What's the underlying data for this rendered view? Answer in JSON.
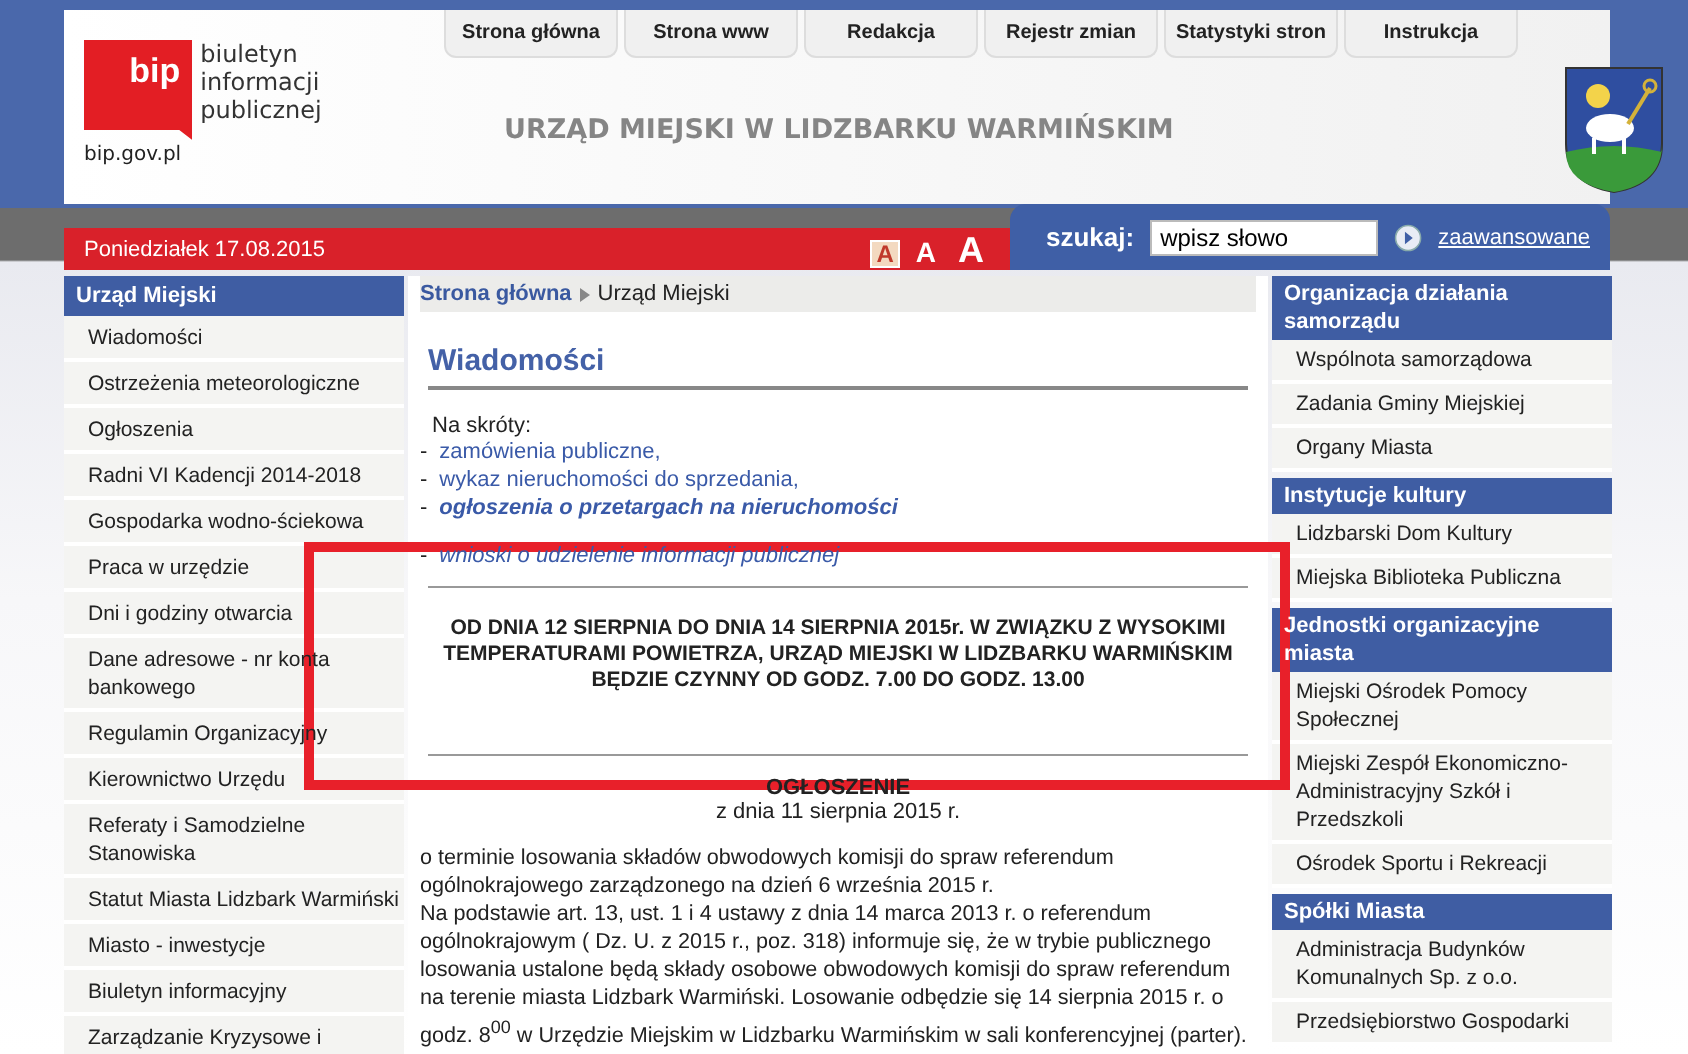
{
  "header": {
    "logo_line_1": "biuletyn",
    "logo_line_2": "informacji publicznej",
    "logo_mark": "bip",
    "logo_url": "bip.gov.pl",
    "title": "URZĄD MIEJSKI W LIDZBARKU WARMIŃSKIM",
    "tabs": [
      {
        "label": "Strona główna",
        "selected": false
      },
      {
        "label": "Strona www",
        "selected": false
      },
      {
        "label": "Redakcja",
        "selected": false
      },
      {
        "label": "Rejestr zmian",
        "selected": false
      },
      {
        "label": "Statystyki stron",
        "selected": false
      },
      {
        "label": "Instrukcja",
        "selected": false
      }
    ]
  },
  "date": "Poniedziałek 17.08.2015",
  "font_sizes": [
    {
      "label": "A",
      "selected": true
    },
    {
      "label": "A",
      "selected": false
    },
    {
      "label": "A",
      "selected": false
    }
  ],
  "search": {
    "label": "szukaj:",
    "value": "wpisz słowo",
    "advanced": "zaawansowane"
  },
  "left_menu": {
    "title": "Urząd Miejski",
    "items": [
      "Wiadomości",
      "Ostrzeżenia meteorologiczne",
      "Ogłoszenia",
      "Radni VI Kadencji 2014-2018",
      "Gospodarka wodno-ściekowa",
      "Praca w urzędzie",
      "Dni i godziny otwarcia",
      "Dane adresowe - nr konta bankowego",
      "Regulamin Organizacyjny",
      "Kierownictwo Urzędu",
      "Referaty i Samodzielne Stanowiska",
      "Statut Miasta Lidzbark Warmiński",
      "Miasto - inwestycje",
      "Biuletyn informacyjny",
      "Zarządzanie Kryzysowe i"
    ]
  },
  "breadcrumb": [
    "Strona główna",
    "Urząd Miejski"
  ],
  "heading": "Wiadomości",
  "shortcuts": {
    "title": "Na skróty:",
    "links": [
      {
        "marker": "-",
        "text": "zamówienia publiczne,",
        "kind": "plain"
      },
      {
        "marker": "-",
        "text": "wykaz nieruchomości do sprzedania,",
        "kind": "plain"
      },
      {
        "marker": "-",
        "text": "ogłoszenia o przetargach na nieruchomości",
        "kind": "emphasis"
      },
      {
        "marker": "-",
        "text": "wnioski o udzielenie informacji publicznej",
        "kind": "slanted"
      }
    ]
  },
  "notice": "OD DNIA 12 SIERPNIA DO DNIA 14 SIERPNIA 2015r. W ZWIĄZKU Z WYSOKIMI TEMPERATURAMI POWIETRZA, URZĄD MIEJSKI W LIDZBARKU WARMIŃSKIM BĘDZIE CZYNNY OD GODZ. 7.00 DO GODZ. 13.00",
  "announcement": {
    "title": "OGŁOSZENIE",
    "date": "z dnia 11 sierpnia 2015 r.",
    "paragraphs": [
      "o terminie losowania składów obwodowych komisji do spraw referendum ogólnokrajowego zarządzonego na dzień 6 września 2015 r.",
      "Na podstawie art. 13, ust. 1 i 4 ustawy z dnia 14 marca 2013 r. o referendum ogólnokrajowym ( Dz. U. z 2015 r., poz. 318) informuje się, że w trybie publicznego losowania ustalone będą składy osobowe obwodowych komisji do spraw referendum na terenie miasta Lidzbark Warmiński. Losowanie odbędzie się 14 sierpnia 2015 r. o godz. 8$^{00}$  w Urzędzie Miejskim w Lidzbarku Warmińskim w sali konferencyjnej (parter)."
    ]
  },
  "right_menu": [
    {
      "title": "Organizacja działania samorządu",
      "items": [
        "Wspólnota samorządowa",
        "Zadania Gminy Miejskiej",
        "Organy Miasta"
      ]
    },
    {
      "title": "Instytucje kultury",
      "items": [
        "Lidzbarski Dom Kultury",
        "Miejska Biblioteka Publiczna"
      ]
    },
    {
      "title": "Jednostki organizacyjne miasta",
      "items": [
        "Miejski Ośrodek Pomocy Społecznej",
        "Miejski Zespół Ekonomiczno-Administracyjny Szkół i Przedszkoli",
        "Ośrodek Sportu i Rekreacji"
      ]
    },
    {
      "title": "Spółki Miasta",
      "items": [
        "Administracja Budynków Komunalnych Sp. z o.o.",
        "Przedsiębiorstwo Gospodarki"
      ]
    }
  ]
}
